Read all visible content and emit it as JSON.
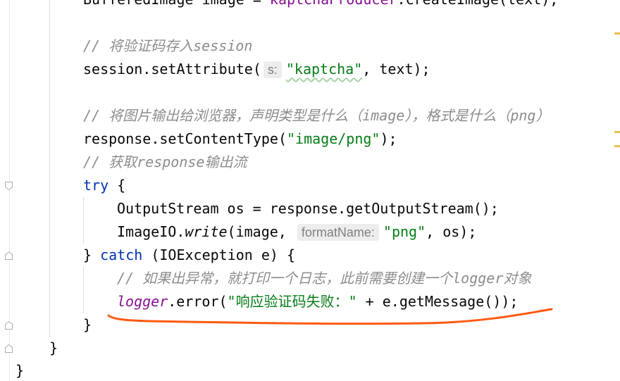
{
  "code": {
    "lines": [
      [
        "BufferedImage image = ",
        "kaptchaProducer",
        ".createImage(text);"
      ],
      [],
      [
        "// 将验证码存入session"
      ],
      [
        "session.setAttribute(",
        "s:",
        "\"kaptcha\"",
        ", text);"
      ],
      [],
      [
        "// 将图片输出给浏览器，声明类型是什么（image），格式是什么（png）"
      ],
      [
        "response.setContentType(",
        "\"image/png\"",
        ");"
      ],
      [
        "// 获取response输出流"
      ],
      [
        "try",
        " {"
      ],
      [
        "OutputStream os = response.getOutputStream();"
      ],
      [
        "ImageIO.",
        "write",
        "(image, ",
        "formatName:",
        "\"png\"",
        ", os);"
      ],
      [
        "} ",
        "catch",
        " (IOException e) {"
      ],
      [
        "// 如果出异常，就打印一个日志，此前需要创建一个logger对象"
      ],
      [
        "logger",
        ".error(",
        "\"响应验证码失败：\"",
        " + e.getMessage());"
      ],
      [
        "}"
      ],
      [
        "}"
      ],
      [
        "}"
      ]
    ]
  },
  "icons": {
    "fold_start": "fold-start-icon",
    "fold_end": "fold-end-icon",
    "warning_stripe": "warning-stripe-mark"
  },
  "colors": {
    "background": "#FFFFFF",
    "text": "#080808",
    "keyword": "#0033B3",
    "string": "#067D17",
    "comment": "#8C8C8C",
    "field": "#871094",
    "hint_text": "#7F7F7F",
    "hint_bg": "#EDEDED",
    "indent_guide": "#DDDDDD",
    "warning_mark": "#E8C24A",
    "annotation": "#FF5A12"
  }
}
